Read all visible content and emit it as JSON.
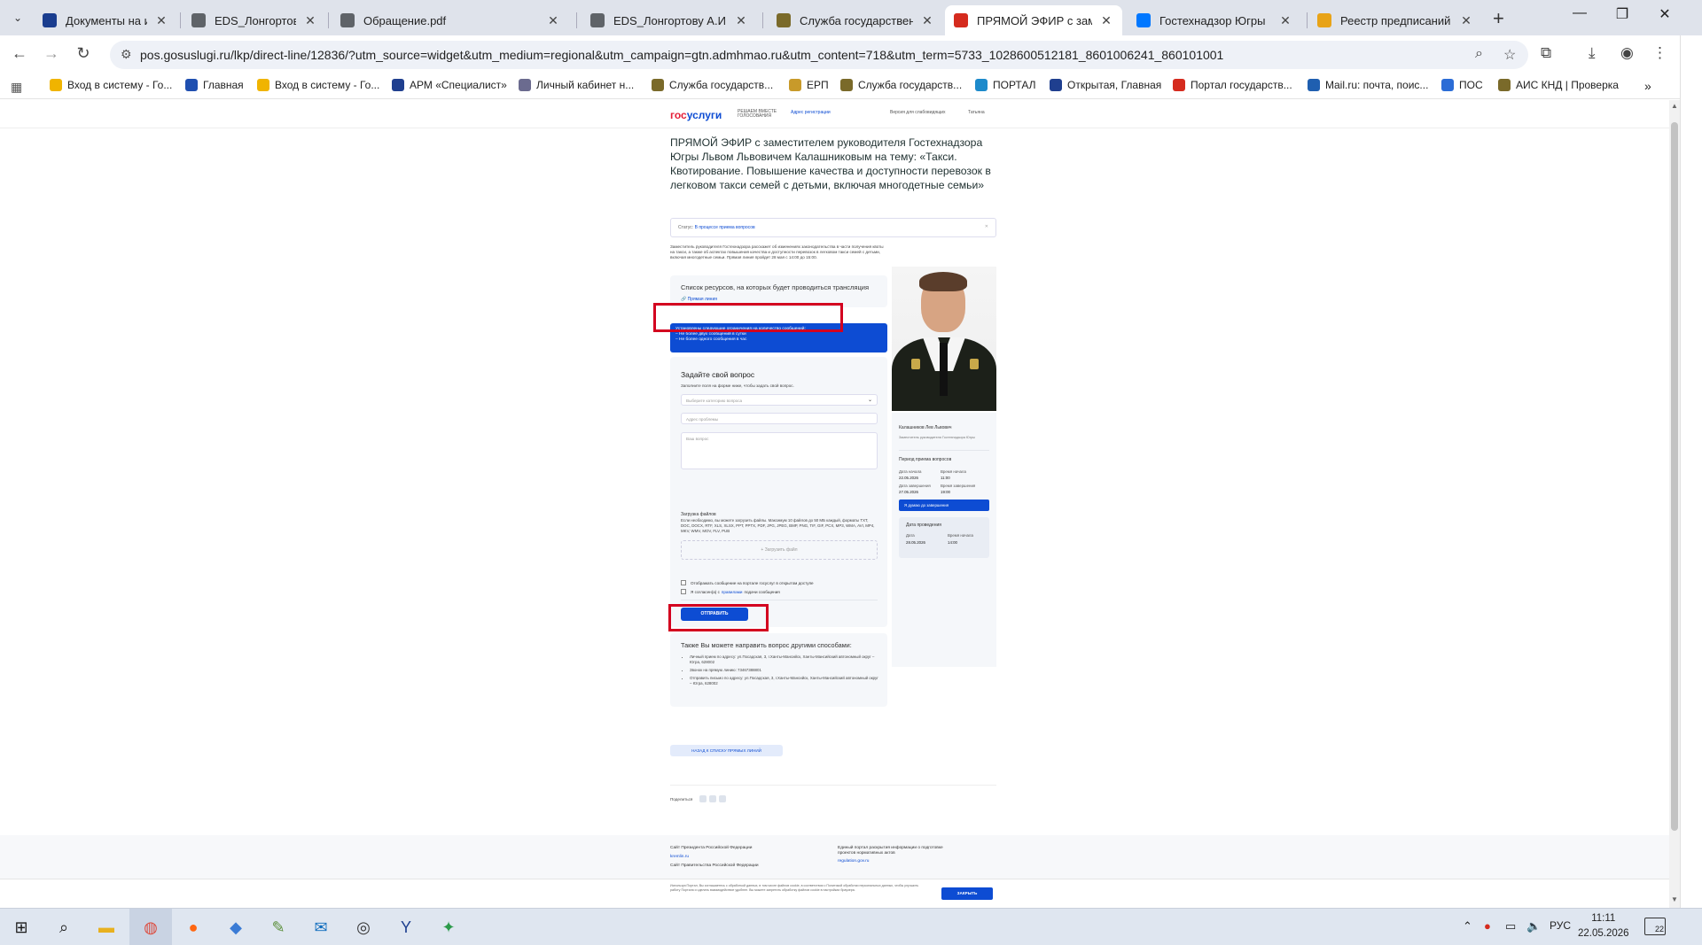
{
  "browser": {
    "tabs": [
      {
        "label": "Документы на исполнен",
        "color": "#1a3d8f"
      },
      {
        "label": "EDS_Лонгортову А.И..do",
        "color": "#5f6368"
      },
      {
        "label": "Обращение.pdf",
        "color": "#5f6368"
      },
      {
        "label": "EDS_Лонгортову А.И..do",
        "color": "#5f6368"
      },
      {
        "label": "Служба государственно",
        "color": "#7a6a2a"
      },
      {
        "label": "ПРЯМОЙ ЭФИР с замест",
        "color": "#d52b1e"
      },
      {
        "label": "Гостехнадзор Югры",
        "color": "#0077ff"
      },
      {
        "label": "Реестр предписаний - Гс",
        "color": "#e8a317"
      }
    ],
    "url": "pos.gosuslugi.ru/lkp/direct-line/12836/?utm_source=widget&utm_medium=regional&utm_campaign=gtn.admhmao.ru&utm_content=718&utm_term=5733_1028600512181_8601006241_860101001",
    "bookmarks": [
      {
        "label": "Вход в систему - Го...",
        "color": "#f0b400"
      },
      {
        "label": "Главная",
        "color": "#1f4fb0"
      },
      {
        "label": "Вход в систему - Го...",
        "color": "#f0b400"
      },
      {
        "label": "АРМ «Специалист»",
        "color": "#1f3f8f"
      },
      {
        "label": "Личный кабинет н...",
        "color": "#6b6b8f"
      },
      {
        "label": "Служба государств...",
        "color": "#7a6a2a"
      },
      {
        "label": "ЕРП",
        "color": "#c89a2a"
      },
      {
        "label": "Служба государств...",
        "color": "#7a6a2a"
      },
      {
        "label": "ПОРТАЛ",
        "color": "#1d8acb"
      },
      {
        "label": "Открытая, Главная",
        "color": "#1f3f8f"
      },
      {
        "label": "Портал государств...",
        "color": "#d52b1e"
      },
      {
        "label": "Mail.ru: почта, поис...",
        "color": "#1f5fb0"
      },
      {
        "label": "ПОС",
        "color": "#2b6cd6"
      },
      {
        "label": "АИС КНД | Проверка",
        "color": "#7a6a2a"
      }
    ]
  },
  "site": {
    "logo_a": "гос",
    "logo_b": "услуги",
    "header_mid": "РЕШАЕМ ВМЕСТЕ ГОЛОСОВАНИЯ",
    "header_geo": "Адрес регистрации",
    "header_access": "Версия для слабовидящих",
    "header_user": "Татьяна"
  },
  "page": {
    "title": "ПРЯМОЙ ЭФИР с заместителем руководителя Гостехнадзора Югры Львом Львовичем Калашниковым на тему: «Такси. Квотирование. Повышение качества и доступности перевозок в легковом такси семей с детьми, включая многодетные семьи»",
    "status_label": "Статус:",
    "status_value": "В процессе приема вопросов",
    "intro": "Заместитель руководителя Гостехнадзора расскажет об изменениях законодательства в части получения квоты на такси, а также об аспектах повышения качества и доступности перевозок в легковом такси семей с детьми, включая многодетные семьи. Прямая линия пройдет 28 мая с 14:00 до 15:00.",
    "resources_title": "Список ресурсов, на которых будет проводиться трансляция",
    "resources_link": "Прямая линия",
    "notice_l1": "Установлены следующие ограничения на количество сообщений:",
    "notice_l2": "– Не более двух сообщений в сутки",
    "notice_l3": "– Не более одного сообщения в час",
    "form_title": "Задайте свой вопрос",
    "form_sub": "Заполните поля на форме ниже, чтобы задать свой вопрос.",
    "select_placeholder": "Выберите категорию вопроса",
    "address_placeholder": "Адрес проблемы",
    "question_placeholder": "Ваш вопрос",
    "upload_title": "Загрузка файлов",
    "upload_text": "Если необходимо, вы можете загрузить файлы. Максимум 10 файлов до 50 МБ каждый, форматы TXT, DOC, DOCX, RTF, XLS, XLSX, PPT, PPTX, PDF, JPG, JPEG, BMP, PNG, TIF, GIF, PCX, MP3, WMA, AVI, MP4, MKV, WMV, MOV, FLV, PUB",
    "upload_button": "+ Загрузить файл",
    "cb1": "Отображать сообщение на портале госуслуг в открытом доступе",
    "cb2_a": "Я согласен(а) с",
    "cb2_link": "правилами",
    "cb2_b": "подачи сообщения",
    "submit": "ОТПРАВИТЬ",
    "other_title": "Также Вы можете направить вопрос другими способами:",
    "other_items": [
      "Личный прием по адресу: ул.Посадская, 3, г.Ханты-Мансийск, Ханты-Мансийский автономный округ – Югра, 628002",
      "Звонок на прямую линию: 73467388801",
      "Отправить письмо по адресу: ул.Посадская, 3, г.Ханты-Мансийск, Ханты-Мансийский автономный округ – Югра, 628002"
    ],
    "back_button": "НАЗАД К СПИСКУ ПРЯМЫХ ЛИНИЙ",
    "share_label": "Поделиться"
  },
  "person": {
    "name": "Калашников Лев Львович",
    "role": "Заместитель руководителя Гостехнадзора Югры",
    "period_title": "Период приема вопросов",
    "start_date_label": "Дата начала",
    "start_date": "22.05.2026",
    "start_time_label": "Время начала",
    "start_time": "11:00",
    "end_date_label": "Дата завершения",
    "end_date": "27.05.2026",
    "end_time_label": "Время завершения",
    "end_time": "19:00",
    "remind_button": "Я думаю до завершения",
    "event_title": "Дата проведения",
    "event_date_label": "Дата",
    "event_date": "28.05.2026",
    "event_time_label": "Время начала",
    "event_time": "14:00"
  },
  "footer": {
    "c1a": "Сайт Президента Российской Федерации",
    "c1b": "kremlin.ru",
    "c1c": "Сайт Правительства Российской Федерации",
    "c2a": "Единый портал раскрытия информации о подготовке проектов нормативных актов",
    "c2b": "regulation.gov.ru",
    "cookie_text": "Используя Портал, Вы соглашаетесь с обработкой данных, в том числе файлов cookie, в соответствии с Политикой обработки персональных данных, чтобы улучшить работу Портала и сделать взаимодействие удобнее. Вы можете запретить обработку файлов cookie в настройках браузера.",
    "cookie_button": "ЗАКРЫТЬ"
  },
  "taskbar": {
    "lang": "РУС",
    "time": "11:11",
    "date": "22.05.2026",
    "notif_count": "22"
  },
  "colors": {
    "brand_blue": "#0d4cd3",
    "highlight_red": "#d3001f"
  }
}
